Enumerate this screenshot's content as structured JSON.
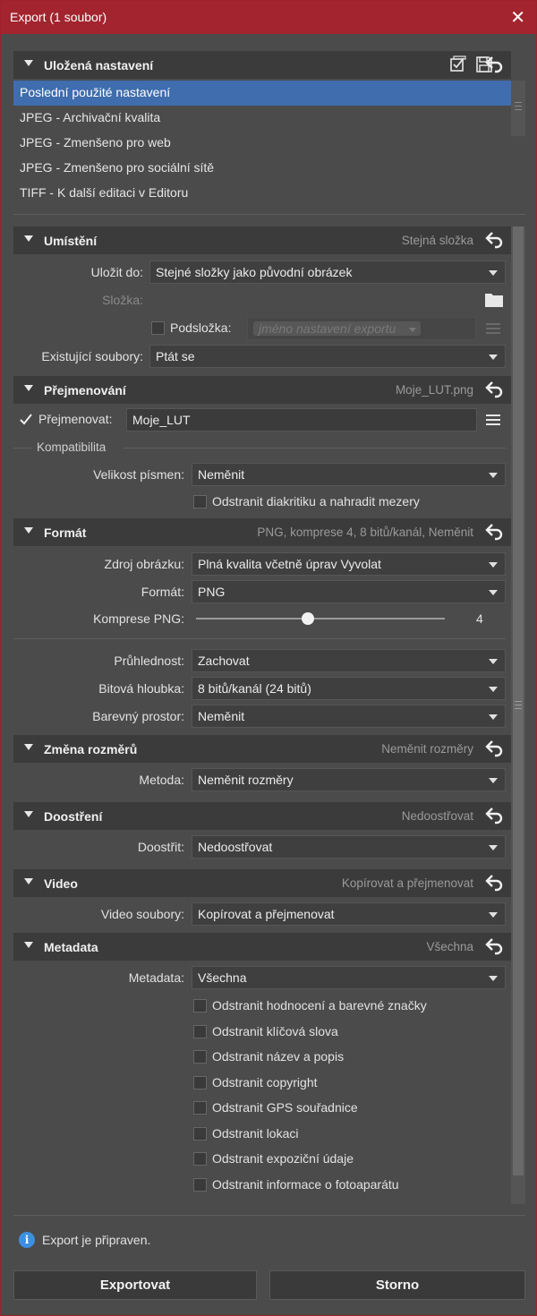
{
  "window": {
    "title": "Export (1 soubor)"
  },
  "saved_settings": {
    "title": "Uložená nastavení",
    "presets": [
      "Poslední použité nastavení",
      "JPEG - Archivační kvalita",
      "JPEG - Zmenšeno pro web",
      "JPEG - Zmenšeno pro sociální sítě",
      "TIFF - K další editaci v Editoru"
    ],
    "selected_index": 0
  },
  "location": {
    "title": "Umístění",
    "summary": "Stejná složka",
    "save_to_label": "Uložit do:",
    "save_to_value": "Stejné složky jako původní obrázek",
    "folder_label": "Složka:",
    "subfolder_label": "Podsložka:",
    "subfolder_placeholder": "jméno nastavení exportu",
    "existing_label": "Existující soubory:",
    "existing_value": "Ptát se"
  },
  "rename": {
    "title": "Přejmenování",
    "summary": "Moje_LUT.png",
    "rename_label": "Přejmenovat:",
    "rename_value": "Moje_LUT",
    "compat_title": "Kompatibilita",
    "case_label": "Velikost písmen:",
    "case_value": "Neměnit",
    "diacritics_label": "Odstranit diakritiku a nahradit mezery"
  },
  "format": {
    "title": "Formát",
    "summary": "PNG, komprese 4, 8 bitů/kanál, Neměnit",
    "source_label": "Zdroj obrázku:",
    "source_value": "Plná kvalita včetně úprav Vyvolat",
    "format_label": "Formát:",
    "format_value": "PNG",
    "compression_label": "Komprese PNG:",
    "compression_value": "4",
    "compression_fraction": 0.45,
    "transparency_label": "Průhlednost:",
    "transparency_value": "Zachovat",
    "depth_label": "Bitová hloubka:",
    "depth_value": "8 bitů/kanál (24 bitů)",
    "colorspace_label": "Barevný prostor:",
    "colorspace_value": "Neměnit"
  },
  "resize": {
    "title": "Změna rozměrů",
    "summary": "Neměnit rozměry",
    "method_label": "Metoda:",
    "method_value": "Neměnit rozměry"
  },
  "sharpen": {
    "title": "Doostření",
    "summary": "Nedoostřovat",
    "label": "Doostřit:",
    "value": "Nedoostřovat"
  },
  "video": {
    "title": "Video",
    "summary": "Kopírovat a přejmenovat",
    "label": "Video soubory:",
    "value": "Kopírovat a přejmenovat"
  },
  "metadata": {
    "title": "Metadata",
    "summary": "Všechna",
    "label": "Metadata:",
    "value": "Všechna",
    "options": [
      "Odstranit hodnocení a barevné značky",
      "Odstranit klíčová slova",
      "Odstranit název a popis",
      "Odstranit copyright",
      "Odstranit GPS souřadnice",
      "Odstranit lokaci",
      "Odstranit expoziční údaje",
      "Odstranit informace o fotoaparátu"
    ]
  },
  "status": {
    "text": "Export je připraven."
  },
  "buttons": {
    "export": "Exportovat",
    "cancel": "Storno"
  }
}
